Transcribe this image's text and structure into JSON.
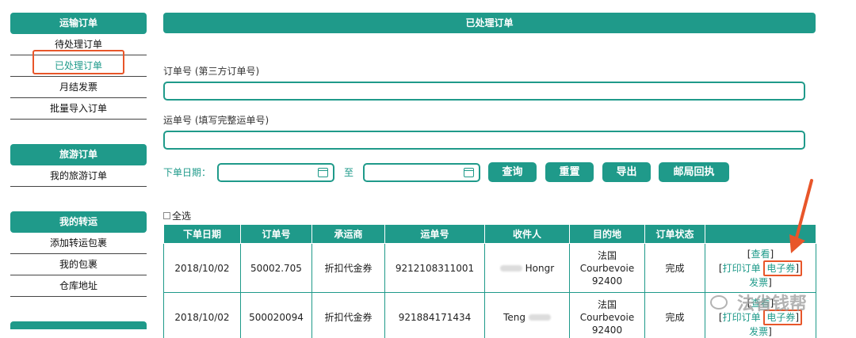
{
  "sidebar": {
    "groups": [
      {
        "title": "运输订单",
        "items": [
          {
            "label": "待处理订单"
          },
          {
            "label": "已处理订单"
          },
          {
            "label": "月结发票"
          },
          {
            "label": "批量导入订单"
          }
        ]
      },
      {
        "title": "旅游订单",
        "items": [
          {
            "label": "我的旅游订单"
          }
        ]
      },
      {
        "title": "我的转运",
        "items": [
          {
            "label": "添加转运包裹"
          },
          {
            "label": "我的包裹"
          },
          {
            "label": "仓库地址"
          }
        ]
      }
    ]
  },
  "main": {
    "title": "已处理订单",
    "order_label": "订单号 (第三方订单号)",
    "order_value": "",
    "tracking_label": "运单号 (填写完整运单号)",
    "tracking_value": "",
    "date_label": "下单日期：",
    "to_label": "至",
    "buttons": {
      "query": "查询",
      "reset": "重置",
      "export": "导出",
      "post": "邮局回执"
    },
    "select_all": "全选"
  },
  "table": {
    "headers": [
      "下单日期",
      "订单号",
      "承运商",
      "运单号",
      "收件人",
      "目的地",
      "订单状态",
      ""
    ],
    "rows": [
      {
        "date": "2018/10/02",
        "order": "50002.705",
        "carrier": "折扣代金券",
        "tracking": "9212108311001",
        "recipient": "Hongr",
        "dest_country": "法国",
        "dest_city": "Courbevoie",
        "dest_zip": "92400",
        "status": "完成"
      },
      {
        "date": "2018/10/02",
        "order": "500020094",
        "carrier": "折扣代金券",
        "tracking": "921884171434",
        "recipient": "Teng",
        "dest_country": "法国",
        "dest_city": "Courbevoie",
        "dest_zip": "92400",
        "status": "完成"
      }
    ],
    "ops": {
      "view": "查看",
      "print": "打印订单",
      "voucher": "电子券",
      "invoice": "发票"
    }
  },
  "watermark": {
    "text": "法省钱帮"
  },
  "colors": {
    "accent": "#1f9a8a",
    "highlight": "#e8562a"
  }
}
